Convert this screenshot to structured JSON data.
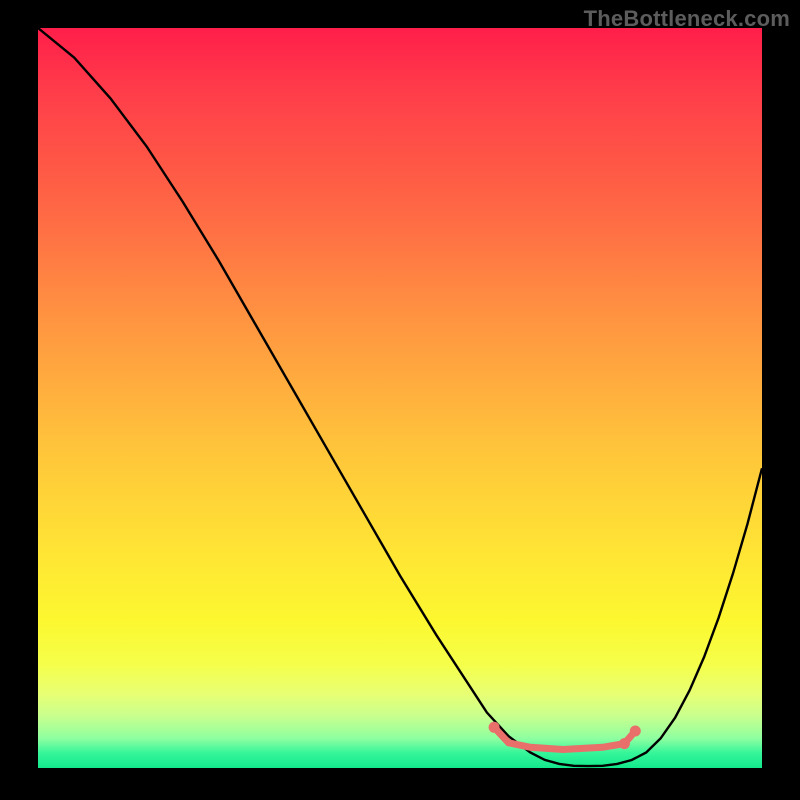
{
  "watermark": "TheBottleneck.com",
  "colors": {
    "curve": "#000000",
    "highlight": "#e96f6b",
    "background_top": "#ff1e4a",
    "background_bottom": "#13e88c"
  },
  "chart_data": {
    "type": "line",
    "title": "",
    "xlabel": "",
    "ylabel": "",
    "xlim": [
      0,
      100
    ],
    "ylim": [
      0,
      100
    ],
    "description": "Bottleneck percentage curve. The horizontal axis represents a hardware-balance position and the vertical axis represents bottleneck percentage (0 at bottom, 100 at top). The valley near x≈65-82 is the optimal range, highlighted in salmon.",
    "series": [
      {
        "name": "bottleneck_curve",
        "x": [
          0,
          5,
          10,
          15,
          20,
          25,
          30,
          35,
          40,
          45,
          50,
          55,
          60,
          62,
          65,
          68,
          70,
          72,
          74,
          76,
          78,
          80,
          82,
          84,
          86,
          88,
          90,
          92,
          94,
          96,
          98,
          100
        ],
        "y": [
          100,
          96,
          90.5,
          84,
          76.5,
          68.5,
          60,
          51.5,
          43,
          34.5,
          26,
          18,
          10.5,
          7.5,
          4.3,
          2.1,
          1.1,
          0.55,
          0.3,
          0.25,
          0.3,
          0.55,
          1.08,
          2.1,
          4.0,
          6.8,
          10.5,
          15.0,
          20.3,
          26.3,
          33.0,
          40.5
        ]
      }
    ],
    "optimal_range": {
      "x_start": 63,
      "x_end": 82,
      "y_flat": 2.8,
      "left_descent_start": {
        "x": 63,
        "y": 5.5
      },
      "right_ascent_end": {
        "x": 82.5,
        "y": 5.0
      }
    }
  }
}
